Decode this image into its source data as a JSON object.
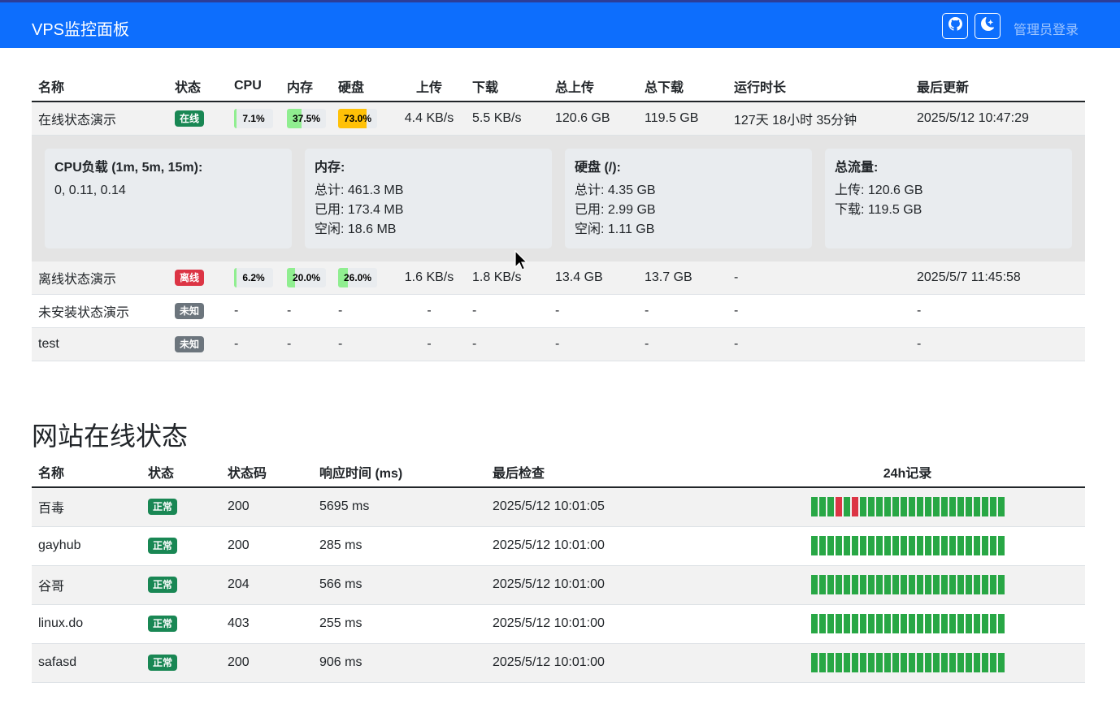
{
  "navbar": {
    "brand": "VPS监控面板",
    "github_icon": "github-icon",
    "theme_icon": "moon-icon",
    "login_label": "管理员登录",
    "bg_color": "#0d6efd"
  },
  "servers": {
    "headers": [
      "名称",
      "状态",
      "CPU",
      "内存",
      "硬盘",
      "上传",
      "下载",
      "总上传",
      "总下载",
      "运行时长",
      "最后更新"
    ],
    "rows": [
      {
        "name": "在线状态演示",
        "status": "在线",
        "status_color": "#198754",
        "cpu": "7.1%",
        "cpu_pct": 7.1,
        "mem": "37.5%",
        "mem_pct": 37.5,
        "disk": "73.0%",
        "disk_pct": 73.0,
        "up": "4.4 KB/s",
        "down": "5.5 KB/s",
        "total_up": "120.6 GB",
        "total_down": "119.5 GB",
        "uptime": "127天 18小时 35分钟",
        "updated": "2025/5/12 10:47:29"
      },
      {
        "name": "离线状态演示",
        "status": "离线",
        "status_color": "#dc3545",
        "cpu": "6.2%",
        "cpu_pct": 6.2,
        "mem": "20.0%",
        "mem_pct": 20.0,
        "disk": "26.0%",
        "disk_pct": 26.0,
        "up": "1.6 KB/s",
        "down": "1.8 KB/s",
        "total_up": "13.4 GB",
        "total_down": "13.7 GB",
        "uptime": "-",
        "updated": "2025/5/7 11:45:58"
      },
      {
        "name": "未安装状态演示",
        "status": "未知",
        "status_color": "#6c757d",
        "cpu": "-",
        "mem": "-",
        "disk": "-",
        "up": "-",
        "down": "-",
        "total_up": "-",
        "total_down": "-",
        "uptime": "-",
        "updated": "-"
      },
      {
        "name": "test",
        "status": "未知",
        "status_color": "#6c757d",
        "cpu": "-",
        "mem": "-",
        "disk": "-",
        "up": "-",
        "down": "-",
        "total_up": "-",
        "total_down": "-",
        "uptime": "-",
        "updated": "-"
      }
    ],
    "detail": {
      "cpu": {
        "title": "CPU负载 (1m, 5m, 15m):",
        "lines": [
          "0, 0.11, 0.14"
        ]
      },
      "mem": {
        "title": "内存:",
        "lines": [
          "总计: 461.3 MB",
          "已用: 173.4 MB",
          "空闲: 18.6 MB"
        ]
      },
      "disk": {
        "title": "硬盘 (/):",
        "lines": [
          "总计: 4.35 GB",
          "已用: 2.99 GB",
          "空闲: 1.11 GB"
        ]
      },
      "traffic": {
        "title": "总流量:",
        "lines": [
          "上传: 120.6 GB",
          "下载: 119.5 GB"
        ]
      }
    }
  },
  "sites": {
    "title": "网站在线状态",
    "headers": [
      "名称",
      "状态",
      "状态码",
      "响应时间 (ms)",
      "最后检查",
      "24h记录"
    ],
    "rows": [
      {
        "name": "百毒",
        "status": "正常",
        "code": "200",
        "resp": "5695 ms",
        "checked": "2025/5/12 10:01:05",
        "history": [
          1,
          1,
          1,
          0,
          1,
          0,
          1,
          1,
          1,
          1,
          1,
          1,
          1,
          1,
          1,
          1,
          1,
          1,
          1,
          1,
          1,
          1,
          1,
          1
        ]
      },
      {
        "name": "gayhub",
        "status": "正常",
        "code": "200",
        "resp": "285 ms",
        "checked": "2025/5/12 10:01:00",
        "history": [
          1,
          1,
          1,
          1,
          1,
          1,
          1,
          1,
          1,
          1,
          1,
          1,
          1,
          1,
          1,
          1,
          1,
          1,
          1,
          1,
          1,
          1,
          1,
          1
        ]
      },
      {
        "name": "谷哥",
        "status": "正常",
        "code": "204",
        "resp": "566 ms",
        "checked": "2025/5/12 10:01:00",
        "history": [
          1,
          1,
          1,
          1,
          1,
          1,
          1,
          1,
          1,
          1,
          1,
          1,
          1,
          1,
          1,
          1,
          1,
          1,
          1,
          1,
          1,
          1,
          1,
          1
        ]
      },
      {
        "name": "linux.do",
        "status": "正常",
        "code": "403",
        "resp": "255 ms",
        "checked": "2025/5/12 10:01:00",
        "history": [
          1,
          1,
          1,
          1,
          1,
          1,
          1,
          1,
          1,
          1,
          1,
          1,
          1,
          1,
          1,
          1,
          1,
          1,
          1,
          1,
          1,
          1,
          1,
          1
        ]
      },
      {
        "name": "safasd",
        "status": "正常",
        "code": "200",
        "resp": "906 ms",
        "checked": "2025/5/12 10:01:00",
        "history": [
          1,
          1,
          1,
          1,
          1,
          1,
          1,
          1,
          1,
          1,
          1,
          1,
          1,
          1,
          1,
          1,
          1,
          1,
          1,
          1,
          1,
          1,
          1,
          1
        ]
      }
    ],
    "ok_color": "#28a745",
    "bad_color": "#dc3545"
  }
}
